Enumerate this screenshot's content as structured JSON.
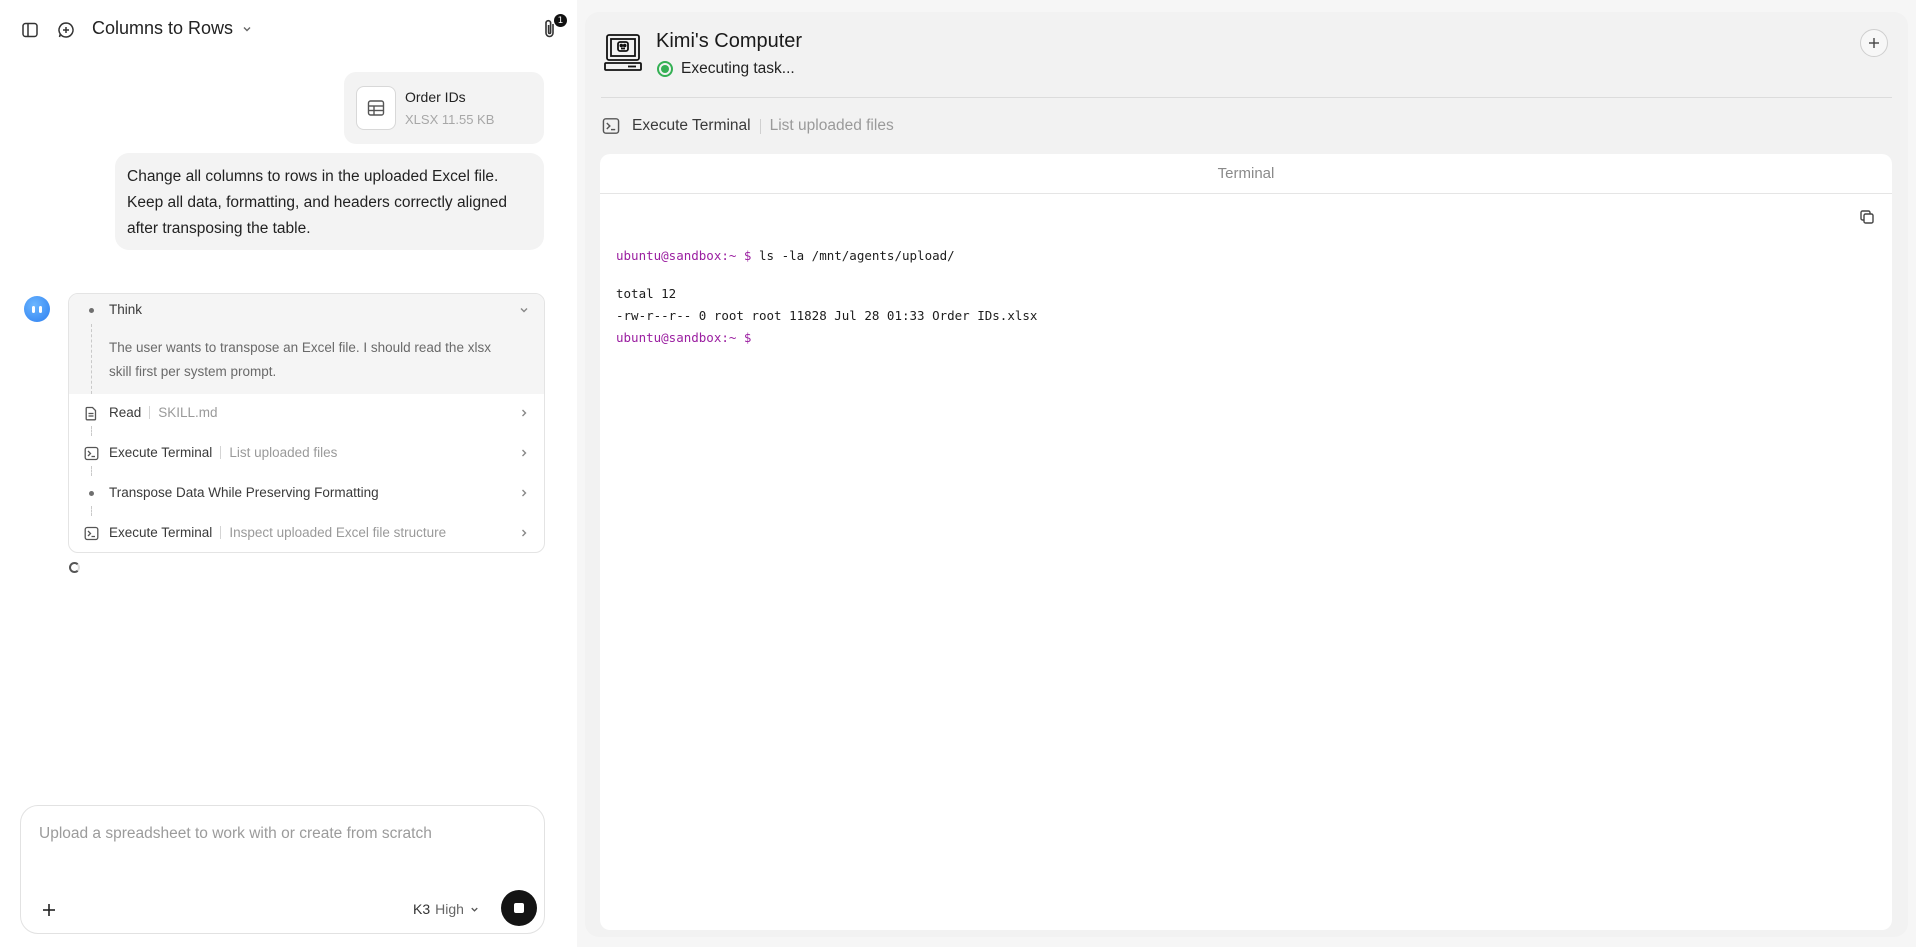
{
  "chat": {
    "title": "Columns to Rows",
    "attachment_count": "1",
    "file": {
      "name": "Order IDs",
      "type": "XLSX",
      "size": "11.55 KB"
    },
    "user_message": "Change all columns to rows in the uploaded Excel file. Keep all data, formatting, and headers correctly aligned after transposing the table.",
    "steps": {
      "think": {
        "label": "Think",
        "body": "The user wants to transpose an Excel file. I should read the xlsx skill first per system prompt."
      },
      "items": [
        {
          "label": "Read",
          "detail": "SKILL.md",
          "icon": "file-icon"
        },
        {
          "label": "Execute Terminal",
          "detail": "List uploaded files",
          "icon": "terminal-icon"
        },
        {
          "label": "Transpose Data While Preserving Formatting",
          "detail": "",
          "icon": "dot"
        },
        {
          "label": "Execute Terminal",
          "detail": "Inspect uploaded Excel file structure",
          "icon": "terminal-icon"
        }
      ]
    },
    "composer": {
      "placeholder": "Upload a spreadsheet to work with or create from scratch",
      "model": "K3",
      "level": "High"
    }
  },
  "computer": {
    "title": "Kimi's Computer",
    "status": "Executing task...",
    "status_color": "#34b054",
    "tool": {
      "label": "Execute Terminal",
      "detail": "List uploaded files"
    },
    "terminal": {
      "header": "Terminal",
      "prompt": "ubuntu@sandbox:~ $",
      "command": "ls -la /mnt/agents/upload/",
      "output": [
        "total 12",
        "-rw-r--r-- 0 root root 11828 Jul 28 01:33 Order IDs.xlsx"
      ],
      "prompt_color": "#9b1fa1"
    }
  }
}
